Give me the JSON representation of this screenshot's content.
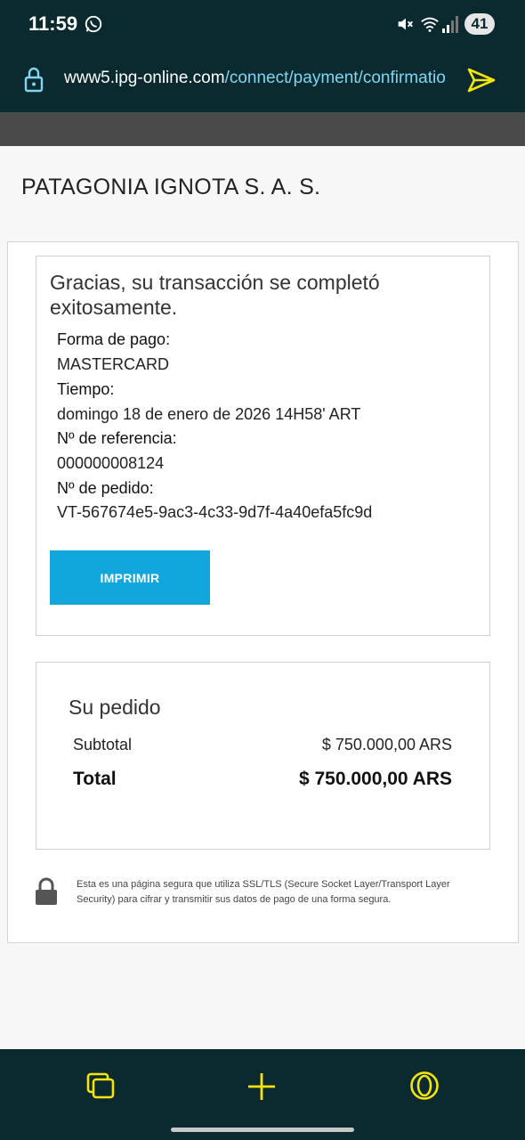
{
  "status_bar": {
    "time": "11:59",
    "battery": "41"
  },
  "browser": {
    "url_host": "www5.ipg-online.com",
    "url_path": "/connect/payment/confirmatio"
  },
  "merchant": {
    "name": "PATAGONIA IGNOTA S. A. S."
  },
  "confirmation": {
    "title": "Gracias, su transacción se completó exitosamente.",
    "payment_method_label": "Forma de pago:",
    "payment_method_value": "MASTERCARD",
    "time_label": "Tiempo:",
    "time_value": "domingo 18 de enero de 2026 14H58' ART",
    "reference_label": "Nº de referencia:",
    "reference_value": "000000008124",
    "order_label": "Nº de pedido:",
    "order_value": "VT-567674e5-9ac3-4c33-9d7f-4a40efa5fc9d",
    "print_button": "IMPRIMIR"
  },
  "order": {
    "title": "Su pedido",
    "subtotal_label": "Subtotal",
    "subtotal_value": "$ 750.000,00 ARS",
    "total_label": "Total",
    "total_value": "$ 750.000,00 ARS"
  },
  "security": {
    "note": "Esta es una página segura que utiliza SSL/TLS (Secure Socket Layer/Transport Layer Security) para cifrar y transmitir sus datos de pago de una forma segura."
  },
  "icons": {
    "status": [
      "whatsapp-icon",
      "mute-icon",
      "wifi-icon",
      "signal-icon"
    ],
    "browser": [
      "lock-icon",
      "send-icon"
    ],
    "nav": [
      "tabs-icon",
      "plus-icon",
      "opera-icon"
    ]
  },
  "colors": {
    "chrome_bg": "#0b2a30",
    "accent_yellow": "#f5e50a",
    "url_path": "#7fd6f2",
    "button_blue": "#11a7dc"
  }
}
